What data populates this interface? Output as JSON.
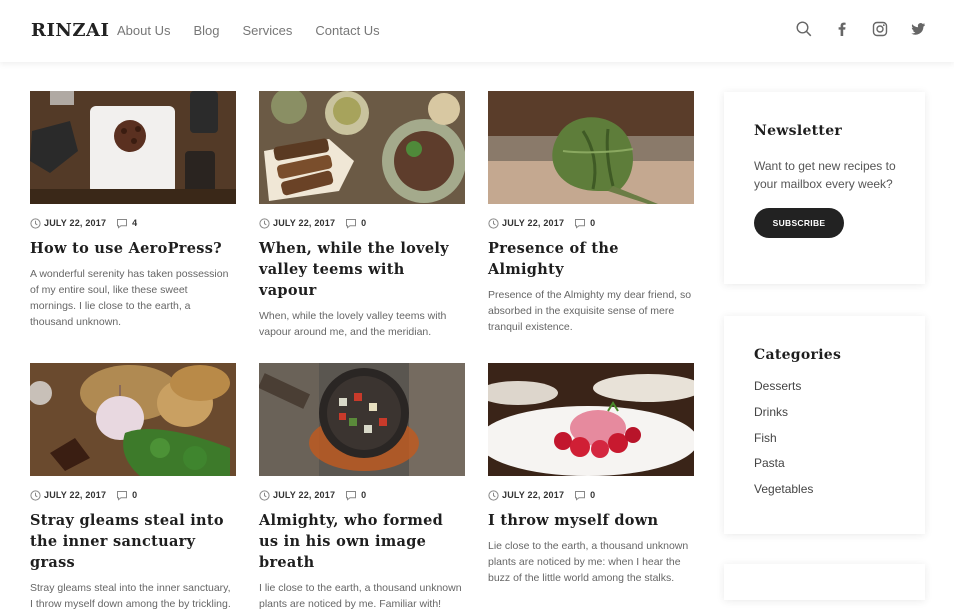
{
  "header": {
    "logo": "RINZAI",
    "nav": [
      "About Us",
      "Blog",
      "Services",
      "Contact Us"
    ]
  },
  "posts": [
    {
      "date": "JULY 22, 2017",
      "comments": "4",
      "title": "How to use AeroPress?",
      "excerpt": "A wonderful serenity has taken possession of my entire soul, like these sweet mornings. I lie close to the earth, a thousand unknown."
    },
    {
      "date": "JULY 22, 2017",
      "comments": "0",
      "title": "When, while the lovely valley teems with vapour",
      "excerpt": "When, while the lovely valley teems with vapour around me, and the meridian."
    },
    {
      "date": "JULY 22, 2017",
      "comments": "0",
      "title": "Presence of the Almighty",
      "excerpt": "Presence of the Almighty my dear friend, so absorbed in the exquisite sense of mere tranquil existence."
    },
    {
      "date": "JULY 22, 2017",
      "comments": "0",
      "title": "Stray gleams steal into the inner sanctuary grass",
      "excerpt": "Stray gleams steal into the inner sanctuary, I throw myself down among the by trickling."
    },
    {
      "date": "JULY 22, 2017",
      "comments": "0",
      "title": "Almighty, who formed us in his own image breath",
      "excerpt": "I lie close to the earth, a thousand unknown plants are noticed by me. Familiar with!"
    },
    {
      "date": "JULY 22, 2017",
      "comments": "0",
      "title": "I throw myself down",
      "excerpt": "Lie close to the earth, a thousand unknown plants are noticed by me: when I hear the buzz of the little world among the stalks."
    }
  ],
  "newsletter": {
    "title": "Newsletter",
    "text": "Want to get new recipes to your mailbox every week?",
    "button": "SUBSCRIBE"
  },
  "categories": {
    "title": "Categories",
    "items": [
      "Desserts",
      "Drinks",
      "Fish",
      "Pasta",
      "Vegetables"
    ]
  },
  "icons": [
    "search-icon",
    "facebook-icon",
    "instagram-icon",
    "twitter-icon",
    "clock-icon",
    "comment-icon"
  ]
}
